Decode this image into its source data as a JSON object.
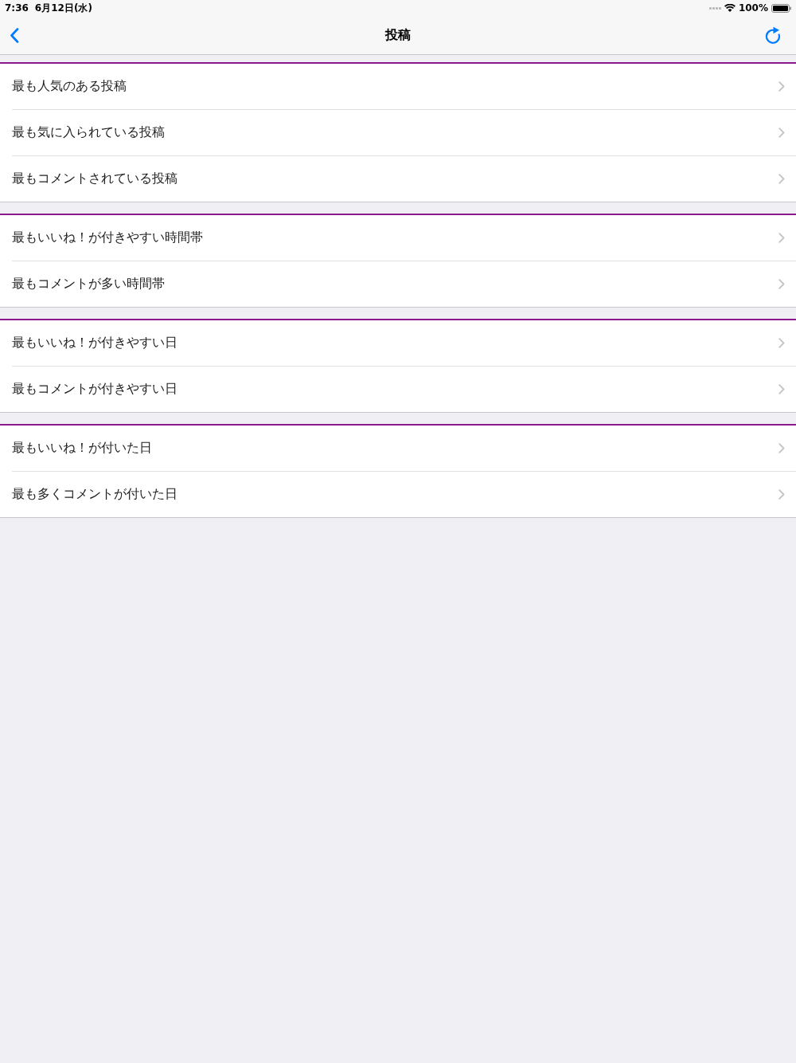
{
  "status_bar": {
    "time": "7:36",
    "date": "6月12日(水)",
    "battery": "100%"
  },
  "navigation_bar": {
    "title": "投稿"
  },
  "sections": [
    {
      "items": [
        {
          "label": "最も人気のある投稿"
        },
        {
          "label": "最も気に入られている投稿"
        },
        {
          "label": "最もコメントされている投稿"
        }
      ]
    },
    {
      "items": [
        {
          "label": "最もいいね！が付きやすい時間帯"
        },
        {
          "label": "最もコメントが多い時間帯"
        }
      ]
    },
    {
      "items": [
        {
          "label": "最もいいね！が付きやすい日"
        },
        {
          "label": "最もコメントが付きやすい日"
        }
      ]
    },
    {
      "items": [
        {
          "label": "最もいいね！が付いた日"
        },
        {
          "label": "最も多くコメントが付いた日"
        }
      ]
    }
  ]
}
